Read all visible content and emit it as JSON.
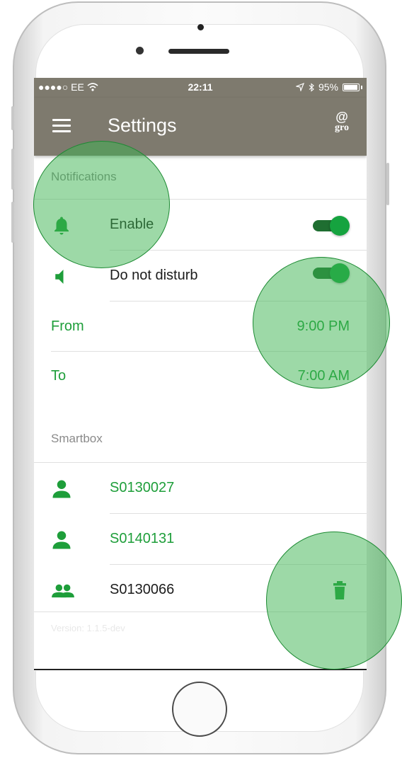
{
  "status_bar": {
    "carrier": "●●●●○ EE",
    "time": "22:11",
    "battery_text": "95%",
    "battery_level": 0.95
  },
  "app_bar": {
    "title": "Settings",
    "logo_text": "gro"
  },
  "notifications": {
    "header": "Notifications",
    "enable": {
      "label": "Enable",
      "on": true
    },
    "do_not_disturb": {
      "label": "Do not disturb",
      "on": true
    },
    "from": {
      "label": "From",
      "value": "9:00 PM"
    },
    "to": {
      "label": "To",
      "value": "7:00 AM"
    }
  },
  "smartbox": {
    "header": "Smartbox",
    "items": [
      {
        "id": "S0130027",
        "icon": "person-icon"
      },
      {
        "id": "S0140131",
        "icon": "person-icon"
      },
      {
        "id": "S0130066",
        "icon": "group-icon"
      }
    ]
  },
  "footer": {
    "version": "Version: 1.1.5-dev"
  },
  "colors": {
    "app_bar": "#7e7a6e",
    "accent_green": "#1e9e3a",
    "toggle_track": "#1f6e31"
  }
}
